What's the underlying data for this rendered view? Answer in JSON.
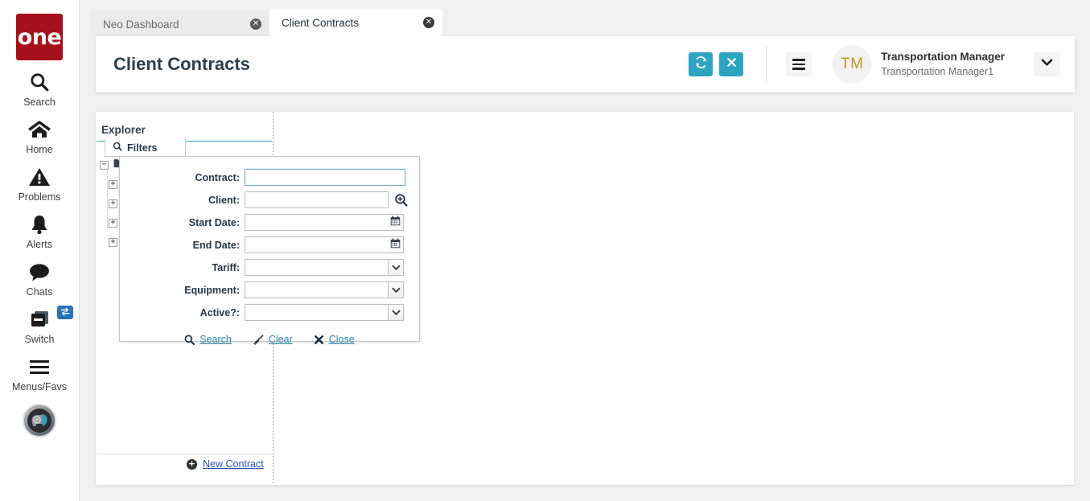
{
  "brand": {
    "logo_text": "one",
    "logo_color": "#a5101a"
  },
  "theme": {
    "accent_teal": "#2fa4c2",
    "link_blue": "#2a50c4",
    "badge_blue": "#2a73b8"
  },
  "rail": {
    "items": [
      {
        "label": "Search",
        "icon": "search-icon"
      },
      {
        "label": "Home",
        "icon": "home-icon"
      },
      {
        "label": "Problems",
        "icon": "warning-triangle-icon"
      },
      {
        "label": "Alerts",
        "icon": "bell-icon"
      },
      {
        "label": "Chats",
        "icon": "chat-bubble-icon"
      },
      {
        "label": "Switch",
        "icon": "switch-cards-icon",
        "badge_icon": "exchange-arrows-icon"
      },
      {
        "label": "Menus/Favs",
        "icon": "hamburger-icon"
      }
    ],
    "assistant_icon": "assistant-avatar-icon"
  },
  "tabs": [
    {
      "label": "Neo Dashboard",
      "active": false,
      "close_icon": "close-circle-icon"
    },
    {
      "label": "Client Contracts",
      "active": true,
      "close_icon": "close-circle-icon"
    }
  ],
  "header": {
    "title": "Client Contracts",
    "refresh_icon": "refresh-icon",
    "close_icon": "close-x-icon",
    "menu_icon": "hamburger-icon",
    "avatar_initials": "TM",
    "user_name": "Transportation Manager",
    "user_role": "Transportation Manager1",
    "chevron_icon": "chevron-down-icon"
  },
  "explorer": {
    "title": "Explorer",
    "filters_tab": {
      "label": "Filters",
      "icon": "search-icon"
    },
    "tree": {
      "root": {
        "toggle": "−",
        "icon": "folder-icon"
      },
      "children": [
        {
          "toggle": "+"
        },
        {
          "toggle": "+"
        },
        {
          "toggle": "+"
        },
        {
          "toggle": "+"
        }
      ]
    },
    "new_contract": {
      "label": "New Contract",
      "icon": "plus-circle-icon"
    }
  },
  "filter_dialog": {
    "fields": [
      {
        "label": "Contract:",
        "type": "text",
        "value": "",
        "focused": true
      },
      {
        "label": "Client:",
        "type": "text-with-lookup",
        "value": "",
        "lookup_icon": "search-plus-icon"
      },
      {
        "label": "Start Date:",
        "type": "date",
        "value": "",
        "icon": "calendar-icon"
      },
      {
        "label": "End Date:",
        "type": "date",
        "value": "",
        "icon": "calendar-icon"
      },
      {
        "label": "Tariff:",
        "type": "select",
        "value": "",
        "icon": "chevron-down-icon"
      },
      {
        "label": "Equipment:",
        "type": "select",
        "value": "",
        "icon": "chevron-down-icon"
      },
      {
        "label": "Active?:",
        "type": "select",
        "value": "",
        "icon": "chevron-down-icon"
      }
    ],
    "actions": [
      {
        "label": "Search",
        "icon": "search-icon"
      },
      {
        "label": "Clear",
        "icon": "eraser-icon"
      },
      {
        "label": "Close",
        "icon": "close-x-icon"
      }
    ]
  }
}
